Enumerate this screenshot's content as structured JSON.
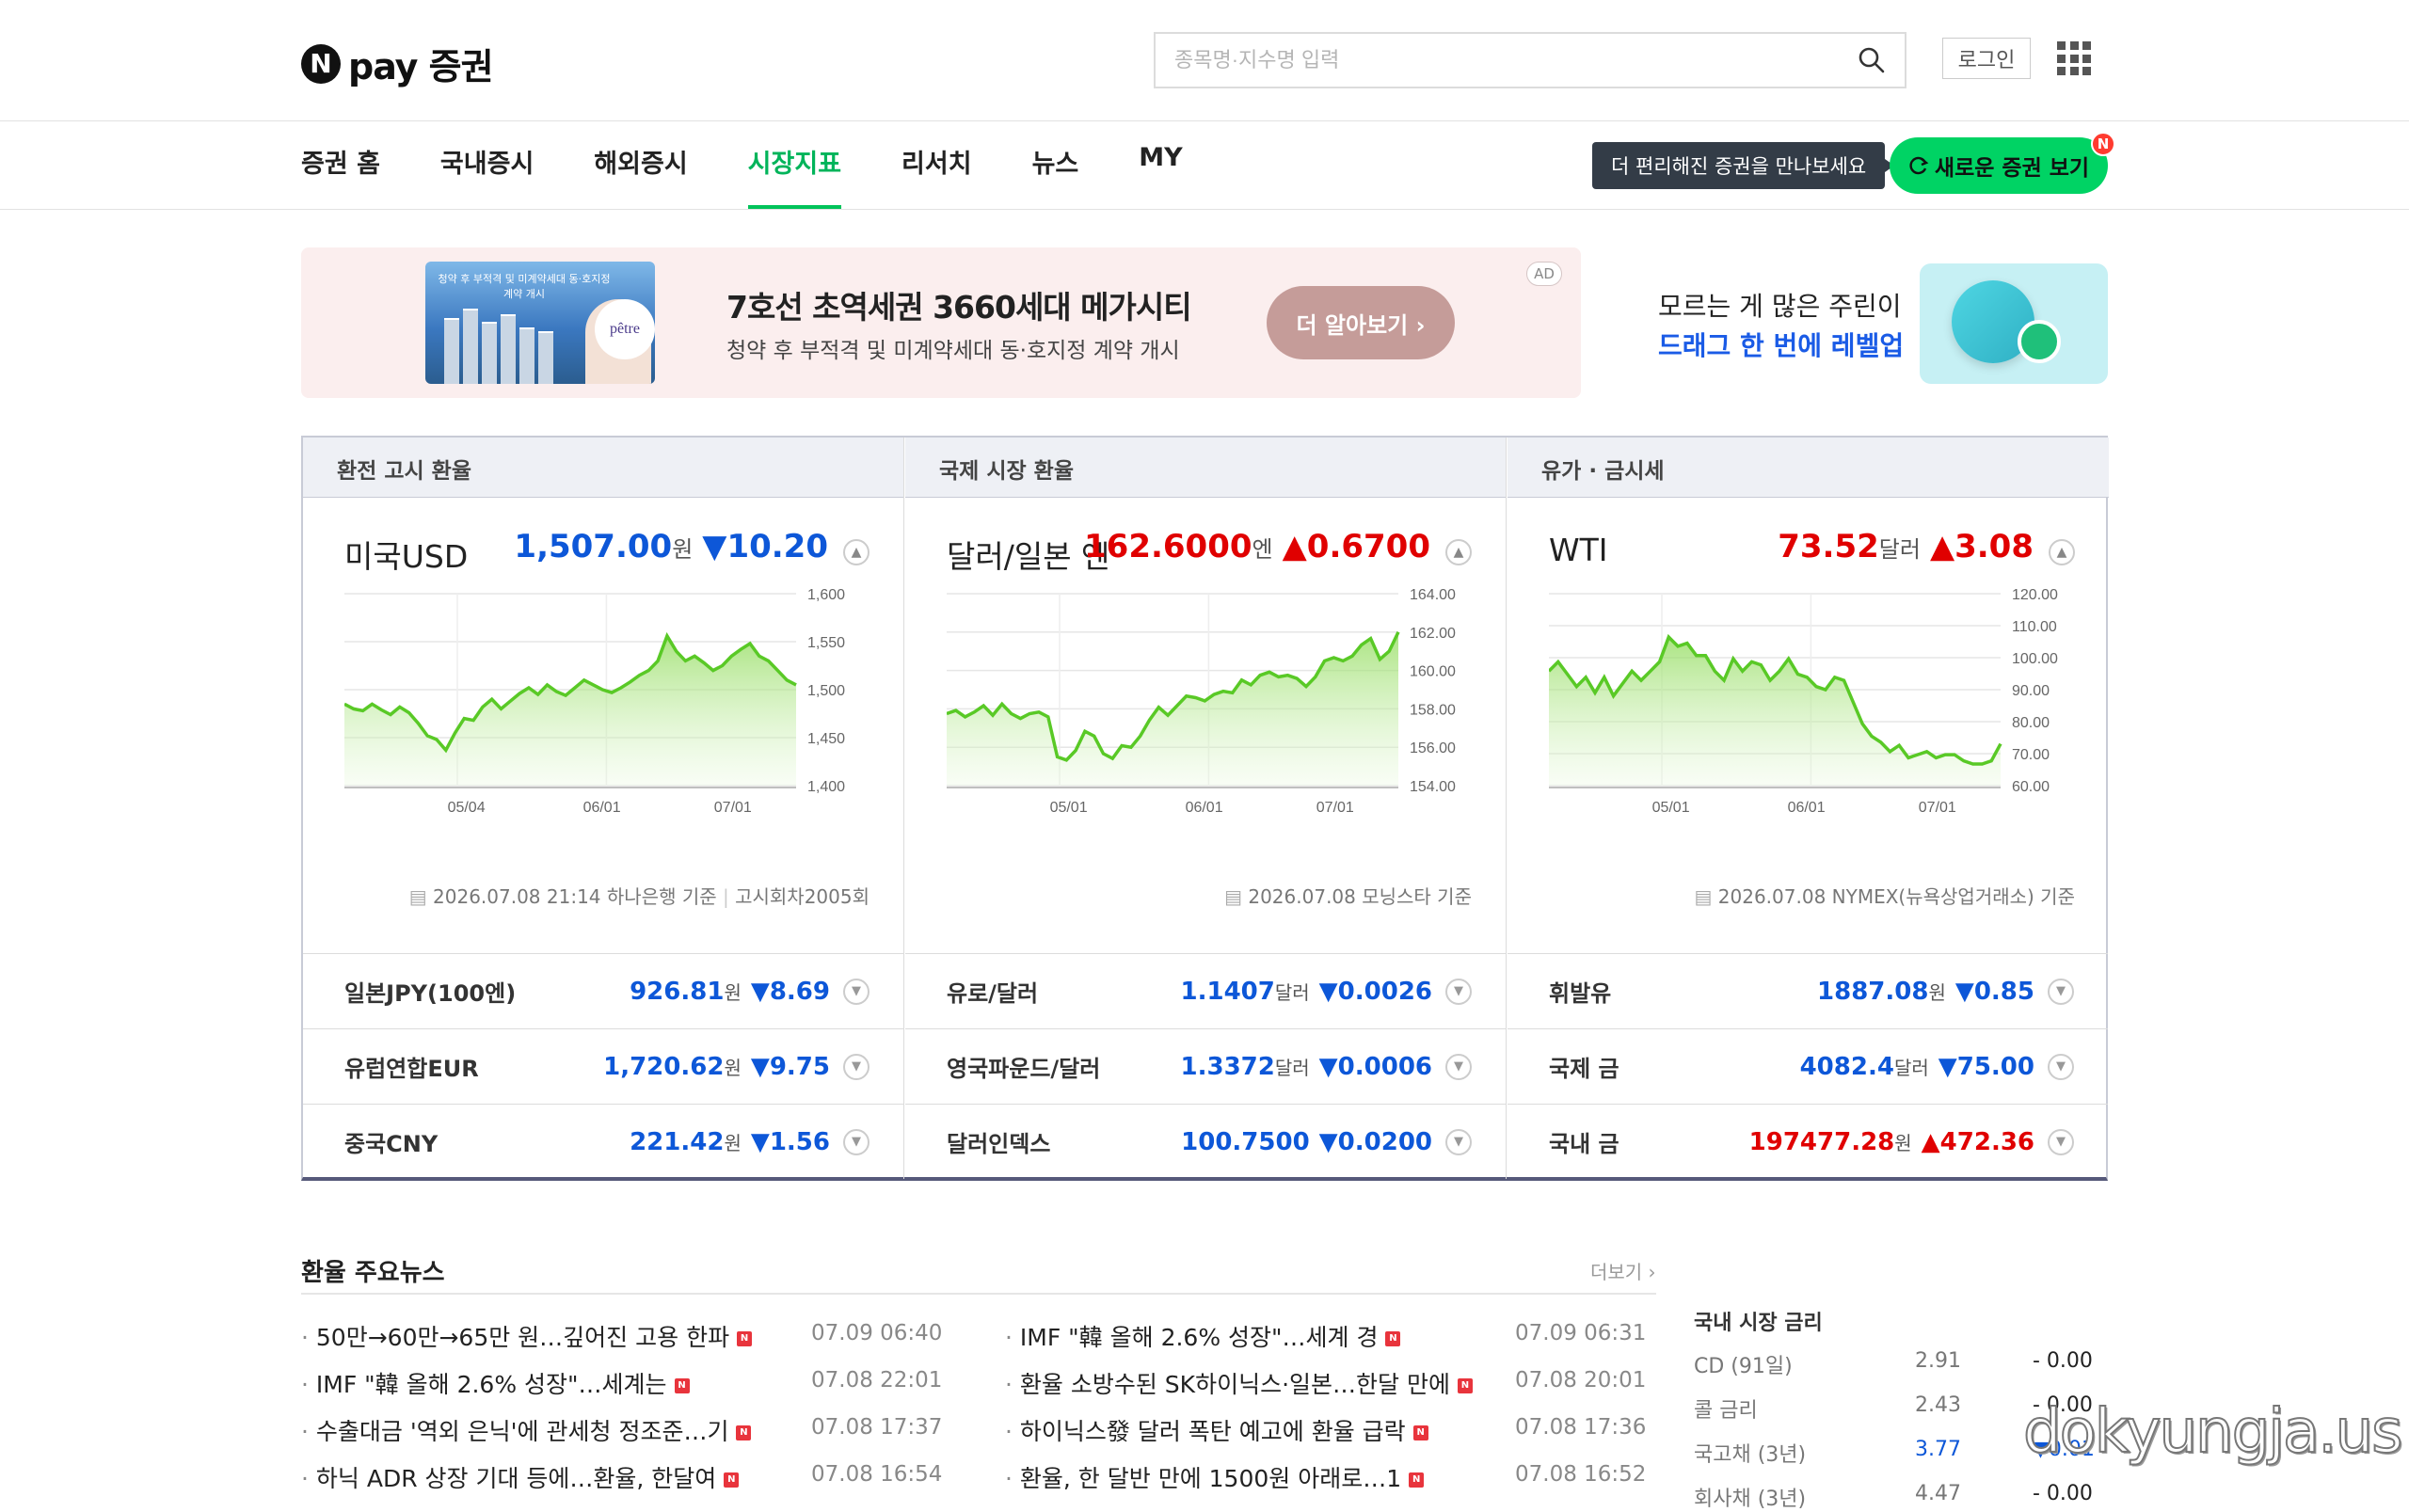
{
  "logo": {
    "text": "pay 증권",
    "mark": "N"
  },
  "search": {
    "placeholder": "종목명·지수명 입력"
  },
  "header": {
    "login": "로그인"
  },
  "nav": {
    "items": [
      "증권 홈",
      "국내증시",
      "해외증시",
      "시장지표",
      "리서치",
      "뉴스",
      "MY"
    ],
    "active": "시장지표"
  },
  "promo_tip": "더 편리해진 증권을 만나보세요",
  "new_button": "새로운 증권 보기",
  "new_badge": "N",
  "ad": {
    "title": "7호선 초역세권 3660세대 메가시티",
    "subtitle": "청약 후 부적격 및 미계약세대 동·호지정 계약 개시",
    "button": "더 알아보기 ›",
    "tag": "AD",
    "image_text": "청약 후 부적격 및 미계약세대 동·호지정 계약 개시",
    "brand": "pêtre"
  },
  "side_promo": {
    "line1": "모르는 게 많은 주린이",
    "line2": "드래그 한 번에 레벨업"
  },
  "market": {
    "columns": [
      {
        "header": "환전 고시 환율",
        "name": "미국USD",
        "value": "1,507.00",
        "unit": "원",
        "change": "▼10.20",
        "dir": "dn",
        "basis_date": "2026.07.08 21:14 하나은행 기준",
        "basis_extra": "고시회차2005회",
        "y_ticks": [
          "1,600",
          "1,550",
          "1,500",
          "1,450",
          "1,400"
        ],
        "x_ticks": [
          "05/04",
          "06/01",
          "07/01"
        ],
        "rows": [
          {
            "name": "일본JPY(100엔)",
            "value": "926.81",
            "unit": "원",
            "change": "▼8.69",
            "dir": "dn"
          },
          {
            "name": "유럽연합EUR",
            "value": "1,720.62",
            "unit": "원",
            "change": "▼9.75",
            "dir": "dn"
          },
          {
            "name": "중국CNY",
            "value": "221.42",
            "unit": "원",
            "change": "▼1.56",
            "dir": "dn"
          }
        ]
      },
      {
        "header": "국제 시장 환율",
        "name": "달러/일본 엔",
        "value": "162.6000",
        "unit": "엔",
        "change": "▲0.6700",
        "dir": "up",
        "basis_date": "2026.07.08 모닝스타 기준",
        "basis_extra": "",
        "y_ticks": [
          "164.00",
          "162.00",
          "160.00",
          "158.00",
          "156.00",
          "154.00"
        ],
        "x_ticks": [
          "05/01",
          "06/01",
          "07/01"
        ],
        "rows": [
          {
            "name": "유로/달러",
            "value": "1.1407",
            "unit": "달러",
            "change": "▼0.0026",
            "dir": "dn"
          },
          {
            "name": "영국파운드/달러",
            "value": "1.3372",
            "unit": "달러",
            "change": "▼0.0006",
            "dir": "dn"
          },
          {
            "name": "달러인덱스",
            "value": "100.7500",
            "unit": "",
            "change": "▼0.0200",
            "dir": "dn"
          }
        ]
      },
      {
        "header": "유가 · 금시세",
        "name": "WTI",
        "value": "73.52",
        "unit": "달러",
        "change": "▲3.08",
        "dir": "up",
        "basis_date": "2026.07.08 NYMEX(뉴욕상업거래소) 기준",
        "basis_extra": "",
        "y_ticks": [
          "120.00",
          "110.00",
          "100.00",
          "90.00",
          "80.00",
          "70.00",
          "60.00"
        ],
        "x_ticks": [
          "05/01",
          "06/01",
          "07/01"
        ],
        "rows": [
          {
            "name": "휘발유",
            "value": "1887.08",
            "unit": "원",
            "change": "▼0.85",
            "dir": "dn"
          },
          {
            "name": "국제 금",
            "value": "4082.4",
            "unit": "달러",
            "change": "▼75.00",
            "dir": "dn"
          },
          {
            "name": "국내 금",
            "value": "197477.28",
            "unit": "원",
            "change": "▲472.36",
            "dir": "up"
          }
        ]
      }
    ]
  },
  "chart_data": [
    {
      "type": "area",
      "series": [
        {
          "values": [
            1485,
            1480,
            1478,
            1485,
            1479,
            1474,
            1482,
            1476,
            1465,
            1452,
            1448,
            1437,
            1455,
            1470,
            1468,
            1482,
            1490,
            1480,
            1488,
            1496,
            1502,
            1495,
            1505,
            1498,
            1494,
            1502,
            1510,
            1505,
            1500,
            1497,
            1502,
            1508,
            1515,
            1520,
            1530,
            1556,
            1540,
            1530,
            1535,
            1528,
            1520,
            1525,
            1535,
            1542,
            1548,
            1535,
            1530,
            1520,
            1510,
            1505
          ]
        }
      ],
      "ylim": [
        1400,
        1600
      ],
      "x_ticks": [
        "05/04",
        "06/01",
        "07/01"
      ]
    },
    {
      "type": "area",
      "series": [
        {
          "values": [
            157.5,
            157.7,
            157.3,
            157.6,
            158.0,
            157.4,
            158.1,
            157.5,
            157.2,
            157.5,
            157.6,
            157.3,
            154.8,
            154.6,
            155.2,
            156.4,
            156.1,
            155.0,
            154.7,
            155.5,
            155.4,
            156.1,
            157.1,
            157.9,
            157.4,
            158.0,
            158.6,
            158.5,
            158.3,
            158.7,
            158.9,
            158.8,
            159.6,
            159.3,
            159.9,
            160.1,
            159.8,
            159.9,
            159.7,
            159.2,
            159.8,
            160.8,
            161.0,
            160.8,
            161.1,
            161.8,
            162.2,
            160.9,
            161.4,
            162.6
          ]
        }
      ],
      "ylim": [
        153,
        165
      ],
      "x_ticks": [
        "05/01",
        "06/01",
        "07/01"
      ]
    },
    {
      "type": "area",
      "series": [
        {
          "values": [
            97,
            100,
            96,
            92,
            95,
            90,
            95,
            89,
            93,
            97,
            94,
            97,
            100,
            108,
            105,
            106,
            102,
            102,
            97,
            94,
            101,
            97,
            100,
            99,
            94,
            97,
            101,
            96,
            95,
            92,
            91,
            95,
            94,
            87,
            80,
            76,
            74,
            71,
            73,
            69,
            70,
            71,
            69,
            70,
            70,
            68,
            67,
            67,
            68,
            73.5
          ]
        }
      ],
      "ylim": [
        60,
        122
      ],
      "x_ticks": [
        "05/01",
        "06/01",
        "07/01"
      ]
    }
  ],
  "news": {
    "title": "환율 주요뉴스",
    "more": "더보기 ›",
    "items": [
      {
        "title": "50만→60만→65만 원…깊어진 고용 한파",
        "time": "07.09 06:40"
      },
      {
        "title": "IMF \"韓 올해 2.6% 성장\"…세계 경",
        "time": "07.09 06:31"
      },
      {
        "title": "IMF \"韓 올해 2.6% 성장\"…세계는",
        "time": "07.08 22:01"
      },
      {
        "title": "환율 소방수된 SK하이닉스·일본…한달 만에",
        "time": "07.08 20:01"
      },
      {
        "title": "수출대금 '역외 은닉'에 관세청 정조준…기",
        "time": "07.08 17:37"
      },
      {
        "title": "하이닉스發 달러 폭탄 예고에 환율 급락",
        "time": "07.08 17:36"
      },
      {
        "title": "하닉 ADR 상장 기대 등에…환율, 한달여",
        "time": "07.08 16:54"
      },
      {
        "title": "환율, 한 달반 만에 1500원 아래로…1",
        "time": "07.08 16:52"
      }
    ],
    "badge": "N"
  },
  "rates": {
    "title": "국내 시장 금리",
    "items": [
      {
        "name": "CD (91일)",
        "value": "2.91",
        "change": "- 0.00",
        "dir": "flat"
      },
      {
        "name": "콜 금리",
        "value": "2.43",
        "change": "- 0.00",
        "dir": "flat"
      },
      {
        "name": "국고채 (3년)",
        "value": "3.77",
        "change": "▼0.01",
        "dir": "dn"
      },
      {
        "name": "회사채 (3년)",
        "value": "4.47",
        "change": "- 0.00",
        "dir": "flat"
      }
    ]
  },
  "watermark": "dokyungja.us",
  "colors": {
    "up": "#e00000",
    "down": "#0d57d8",
    "accent": "#00c35a",
    "chart_line": "#59c926"
  }
}
